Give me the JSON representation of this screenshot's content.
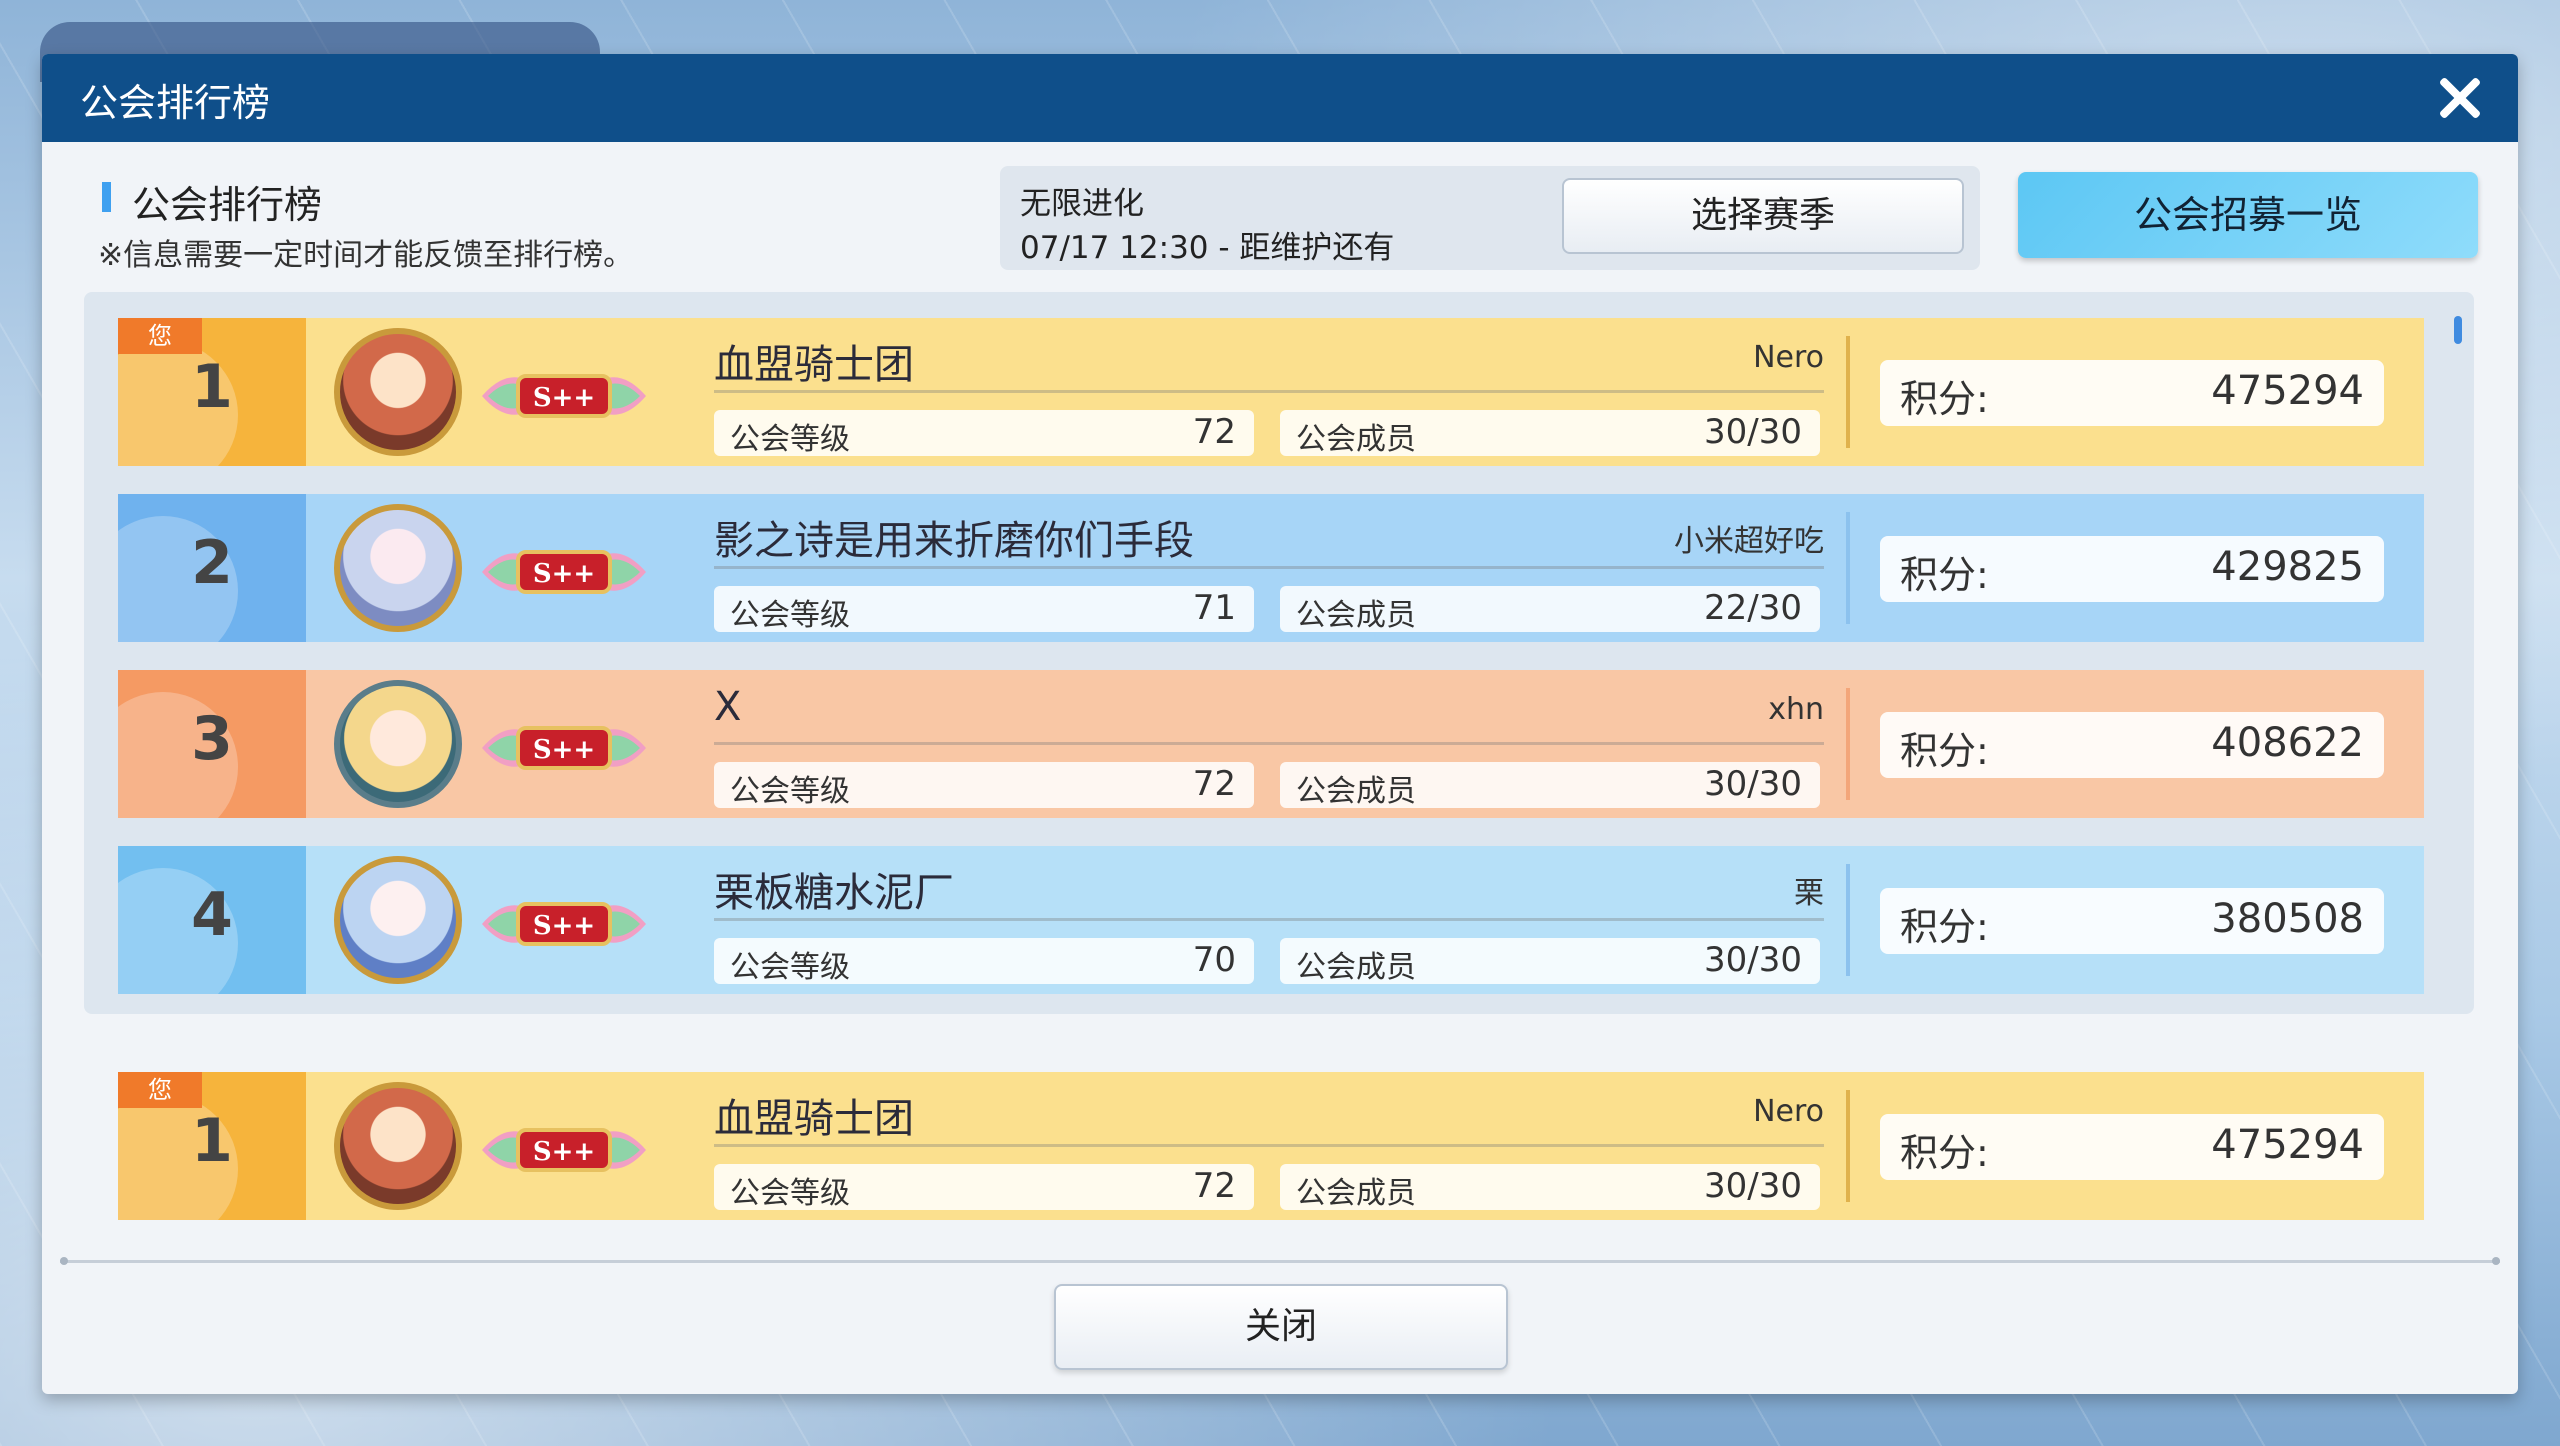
{
  "window": {
    "title": "公会排行榜"
  },
  "header": {
    "section_title": "公会排行榜",
    "note": "※信息需要一定时间才能反馈至排行榜。",
    "season_name": "无限进化",
    "season_time": "07/17 12:30 - 距维护还有",
    "select_season_label": "选择赛季",
    "recruit_label": "公会招募一览"
  },
  "labels": {
    "level": "公会等级",
    "members": "公会成员",
    "score": "积分:",
    "grade": "S++",
    "you": "您"
  },
  "rankings": [
    {
      "rank": "1",
      "name": "血盟骑士团",
      "leader": "Nero",
      "level": "72",
      "members": "30/30",
      "score": "475294",
      "theme": "gold",
      "avatar": "guild-avatar-red"
    },
    {
      "rank": "2",
      "name": "影之诗是用来折磨你们手段",
      "leader": "小米超好吃",
      "level": "71",
      "members": "22/30",
      "score": "429825",
      "theme": "blue",
      "avatar": "guild-avatar-silver"
    },
    {
      "rank": "3",
      "name": "X",
      "leader": "xhn",
      "level": "72",
      "members": "30/30",
      "score": "408622",
      "theme": "peach",
      "avatar": "guild-avatar-blonde"
    },
    {
      "rank": "4",
      "name": "栗板糖水泥厂",
      "leader": "栗",
      "level": "70",
      "members": "30/30",
      "score": "380508",
      "theme": "sky",
      "avatar": "guild-avatar-azure"
    }
  ],
  "my_guild": {
    "rank": "1",
    "name": "血盟骑士团",
    "leader": "Nero",
    "level": "72",
    "members": "30/30",
    "score": "475294"
  },
  "footer": {
    "close_label": "关闭"
  }
}
